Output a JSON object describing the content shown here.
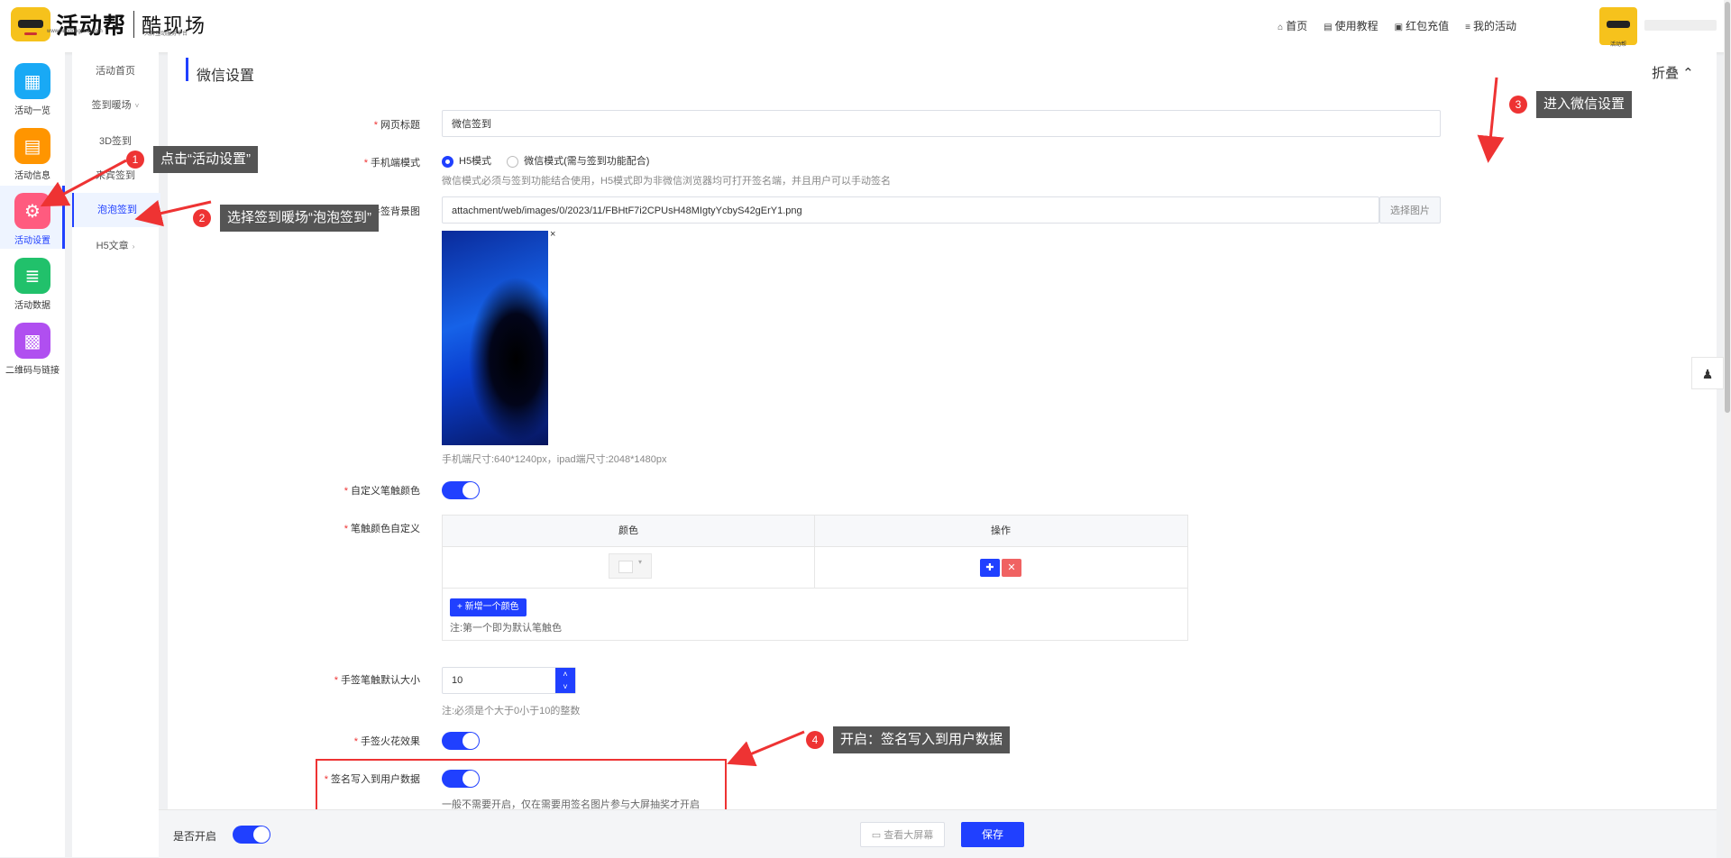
{
  "header": {
    "logo_main": "活动帮",
    "logo_main_sub": "www.huodongcool.com",
    "logo_second": "酷现场",
    "logo_second_sub": "大屏互动服务平台",
    "nav": [
      {
        "icon": "home-icon",
        "glyph": "⌂",
        "label": "首页"
      },
      {
        "icon": "book-icon",
        "glyph": "▤",
        "label": "使用教程"
      },
      {
        "icon": "wallet-icon",
        "glyph": "▣",
        "label": "红包充值"
      },
      {
        "icon": "list-icon",
        "glyph": "≡",
        "label": "我的活动"
      }
    ],
    "avatar_caption": "活动帮"
  },
  "rail": [
    {
      "label": "活动一览",
      "color": "#19a9f5",
      "glyph": "▦",
      "icon": "grid-icon"
    },
    {
      "label": "活动信息",
      "color": "#ff9500",
      "glyph": "▤",
      "icon": "document-icon"
    },
    {
      "label": "活动设置",
      "color": "#ff5b7f",
      "glyph": "⚙",
      "icon": "gear-icon"
    },
    {
      "label": "活动数据",
      "color": "#21c16b",
      "glyph": "≣",
      "icon": "database-icon"
    },
    {
      "label": "二维码与链接",
      "color": "#b04ff0",
      "glyph": "▩",
      "icon": "qrcode-icon"
    }
  ],
  "submenu": [
    {
      "label": "活动首页"
    },
    {
      "label": "签到暖场",
      "chev": "˅"
    },
    {
      "label": "3D签到"
    },
    {
      "label": "来宾签到"
    },
    {
      "label": "泡泡签到"
    },
    {
      "label": "H5文章",
      "chev": "›"
    }
  ],
  "panel": {
    "title": "微信设置",
    "fold": "折叠 ⌃"
  },
  "form": {
    "page_title_label": "网页标题",
    "page_title_value": "微信签到",
    "mode_label": "手机端模式",
    "mode_h5": "H5模式",
    "mode_wechat": "微信模式(需与签到功能配合)",
    "mode_hint": "微信模式必须与签到功能结合使用，H5模式即为非微信浏览器均可打开签名端，并且用户可以手动签名",
    "bg_label": "手签背景图",
    "bg_path": "attachment/web/images/0/2023/11/FBHtF7i2CPUsH48MIgtyYcbyS42gErY1.png",
    "bg_button": "选择图片",
    "bg_remove": "×",
    "bg_hint": "手机端尺寸:640*1240px，ipad端尺寸:2048*1480px",
    "custom_color_label": "自定义笔触颜色",
    "color_table_label": "笔触颜色自定义",
    "col_color": "颜色",
    "col_action": "操作",
    "add_glyph": "✚",
    "del_glyph": "✕",
    "add_color": "+ 新增一个颜色",
    "color_note": "注:第一个即为默认笔触色",
    "size_label": "手签笔触默认大小",
    "size_value": "10",
    "size_up": "˄",
    "size_down": "˅",
    "size_hint": "注:必须是个大于0小于10的整数",
    "spark_label": "手签火花效果",
    "write_label": "签名写入到用户数据",
    "write_hint": "一般不需要开启，仅在需要用签名图片参与大屏抽奖才开启",
    "req": "*"
  },
  "footer": {
    "enable_label": "是否开启",
    "view_button": "▭ 查看大屏幕",
    "save_button": "保存"
  },
  "side_float": "♟",
  "annotations": [
    {
      "num": "1",
      "text": "点击“活动设置”"
    },
    {
      "num": "2",
      "text": "选择签到暖场“泡泡签到”"
    },
    {
      "num": "3",
      "text": "进入微信设置"
    },
    {
      "num": "4",
      "text": "开启：签名写入到用户数据"
    }
  ],
  "colors": {
    "accent": "#2040ff",
    "annotation_red": "#e33333",
    "callout_bg": "#555555"
  }
}
